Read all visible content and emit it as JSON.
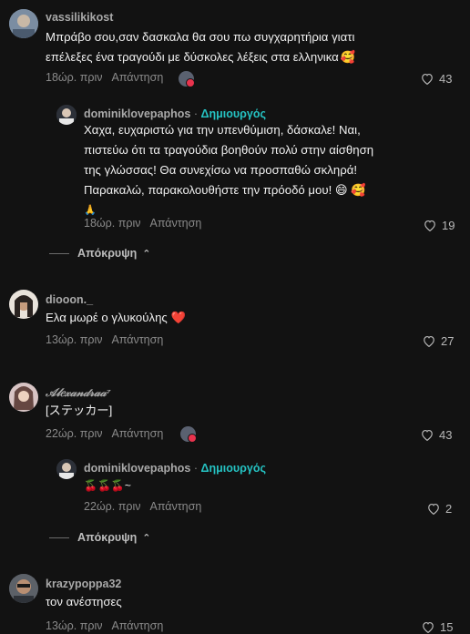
{
  "comments": [
    {
      "username": "vassilikikost",
      "text_line1": "Μπράβο σου,σαν δασκαλα θα σου πω συγχαρητήρια γιατι",
      "text_line2": "επέλεξες ένα τραγούδι με δύσκολες λέξεις στα ελληνικα",
      "text_emoji": "🥰",
      "time": "18ώρ. πριν",
      "reply_label": "Απάντηση",
      "likes": "43",
      "replies": [
        {
          "username": "dominiklovepaphos",
          "separator": "·",
          "creator_label": "Δημιουργός",
          "text_line1": "Χαχα, ευχαριστώ για την υπενθύμιση, δάσκαλε! Ναι,",
          "text_line2": "πιστεύω ότι τα τραγούδια βοηθούν πολύ στην αίσθηση",
          "text_line3": "της γλώσσας! Θα συνεχίσω να προσπαθώ σκληρά!",
          "text_line4": "Παρακαλώ, παρακολουθήστε την πρόοδό μου!",
          "text_emoji": "😄 🥰",
          "text_line5": "🙏",
          "time": "18ώρ. πριν",
          "reply_label": "Απάντηση",
          "likes": "19"
        }
      ],
      "collapse_label": "Απόκρυψη"
    },
    {
      "username": "diooon._",
      "text_line1": "Ελα μωρέ ο γλυκούλης",
      "text_emoji": "❤️",
      "time": "13ώρ. πριν",
      "reply_label": "Απάντηση",
      "likes": "27"
    },
    {
      "username": "𝒜𝓁𝑒𝓍𝒶𝓃𝒹𝓇𝒶𝒶⁷",
      "text_line1": "[ステッカー]",
      "time": "22ώρ. πριν",
      "reply_label": "Απάντηση",
      "likes": "43",
      "replies": [
        {
          "username": "dominiklovepaphos",
          "separator": "·",
          "creator_label": "Δημιουργός",
          "text_line1": "🍒🍒🍒~",
          "time": "22ώρ. πριν",
          "reply_label": "Απάντηση",
          "likes": "2"
        }
      ],
      "collapse_label": "Απόκρυψη"
    },
    {
      "username": "krazypoppa32",
      "text_line1": "τον ανέστησες",
      "time": "13ώρ. πριν",
      "reply_label": "Απάντηση",
      "likes": "15"
    }
  ]
}
